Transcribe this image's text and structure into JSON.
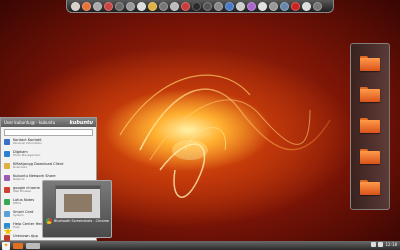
{
  "colors": {
    "accent": "#f07a1a",
    "folder": "#ff9a4a",
    "menu_bg": "#f2f2f2",
    "panel": "#2a2a2a"
  },
  "dock": {
    "icons": [
      {
        "name": "chrome-icon",
        "color": "#d8d0c8"
      },
      {
        "name": "ubuntu-icon",
        "color": "#e8723a"
      },
      {
        "name": "app-icon",
        "color": "#aaaaaa"
      },
      {
        "name": "app-icon",
        "color": "#cc4444"
      },
      {
        "name": "app-icon",
        "color": "#6a6a6a"
      },
      {
        "name": "app-icon",
        "color": "#999999"
      },
      {
        "name": "media-player-icon",
        "color": "#dddddd"
      },
      {
        "name": "chrome-icon",
        "color": "#e0b040"
      },
      {
        "name": "app-icon",
        "color": "#777777"
      },
      {
        "name": "app-icon",
        "color": "#bbbbbb"
      },
      {
        "name": "app-icon",
        "color": "#cc3b3b"
      },
      {
        "name": "app-icon",
        "color": "#2a2a2a"
      },
      {
        "name": "app-icon",
        "color": "#555555"
      },
      {
        "name": "app-icon",
        "color": "#8a8a8a"
      },
      {
        "name": "app-icon",
        "color": "#4a7ac8"
      },
      {
        "name": "app-icon",
        "color": "#cccccc"
      },
      {
        "name": "app-icon",
        "color": "#aa66cc"
      },
      {
        "name": "app-icon",
        "color": "#e0e0e0"
      },
      {
        "name": "app-icon",
        "color": "#999999"
      },
      {
        "name": "app-icon",
        "color": "#6688aa"
      },
      {
        "name": "app-icon",
        "color": "#cc2222"
      },
      {
        "name": "app-icon",
        "color": "#dddddd"
      },
      {
        "name": "app-icon",
        "color": "#777777"
      }
    ]
  },
  "kickoff": {
    "user_label": "User kubuntu@ - kubuntu",
    "brand": "kubuntu",
    "search_placeholder": "",
    "items": [
      {
        "icon": "#3a6fc8",
        "title": "Kontact Kontakt",
        "subtitle": "Personal Information"
      },
      {
        "icon": "#2b80d0",
        "title": "Digikam",
        "subtitle": "Photo Management"
      },
      {
        "icon": "#e0b040",
        "title": "KMahjongg Download Client",
        "subtitle": "Download"
      },
      {
        "icon": "#9a5ab0",
        "title": "Kubuntu Network Share",
        "subtitle": "Network"
      },
      {
        "icon": "#d04030",
        "title": "google chrome",
        "subtitle": "Web Browser"
      },
      {
        "icon": "#3aa757",
        "title": "Lotus Notes",
        "subtitle": "Office"
      },
      {
        "icon": "#5aa0d8",
        "title": "Smart Card",
        "subtitle": "System"
      },
      {
        "icon": "#2a8ad0",
        "title": "Help Center Help",
        "subtitle": "Help"
      },
      {
        "icon": "#c0392b",
        "title": "Unknown App",
        "subtitle": ""
      }
    ]
  },
  "preview": {
    "caption": "Bluetooth Screenshots - Chrome"
  },
  "taskbar": {
    "start_glyph": "✦",
    "clock": "12:18",
    "tasks": [
      {
        "color": "#e07020",
        "width_label": "task-1"
      },
      {
        "color": "#bbbbbb",
        "width_label": "task-2"
      }
    ]
  },
  "right_panel": {
    "folders": [
      "folder-1",
      "folder-2",
      "folder-3",
      "folder-4",
      "folder-5"
    ]
  }
}
